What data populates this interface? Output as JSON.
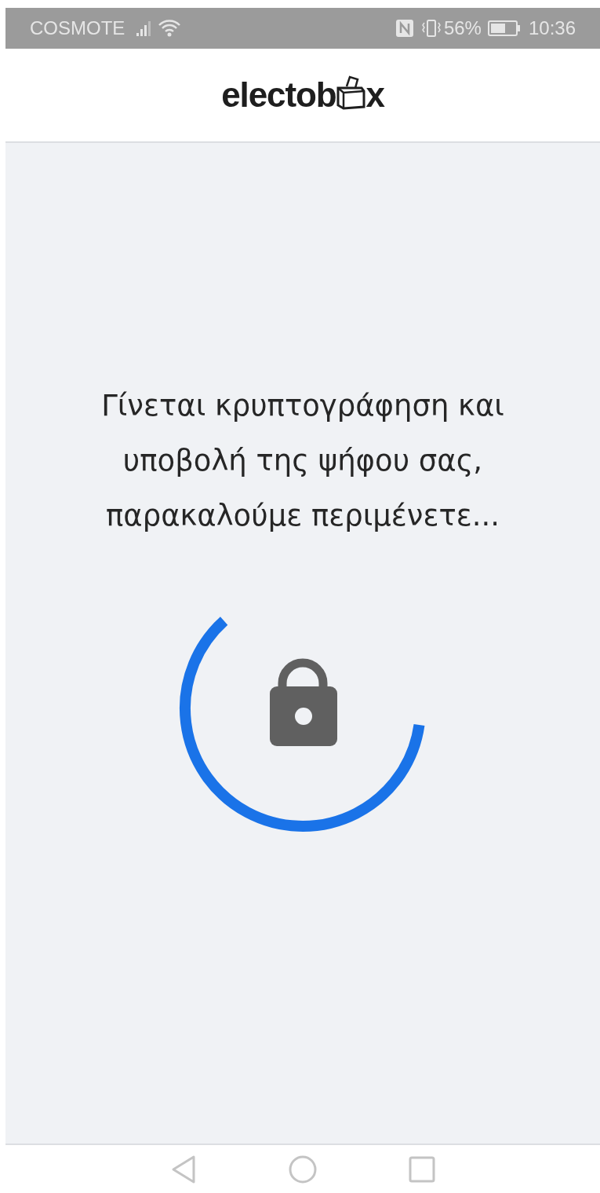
{
  "status_bar": {
    "carrier": "COSMOTE",
    "battery": "56%",
    "time": "10:36"
  },
  "header": {
    "logo_start": "electob",
    "logo_end": "x"
  },
  "message": "Γίνεται κρυπτογράφηση και υποβολή της ψήφου σας, παρακαλούμε περιμένετε..."
}
